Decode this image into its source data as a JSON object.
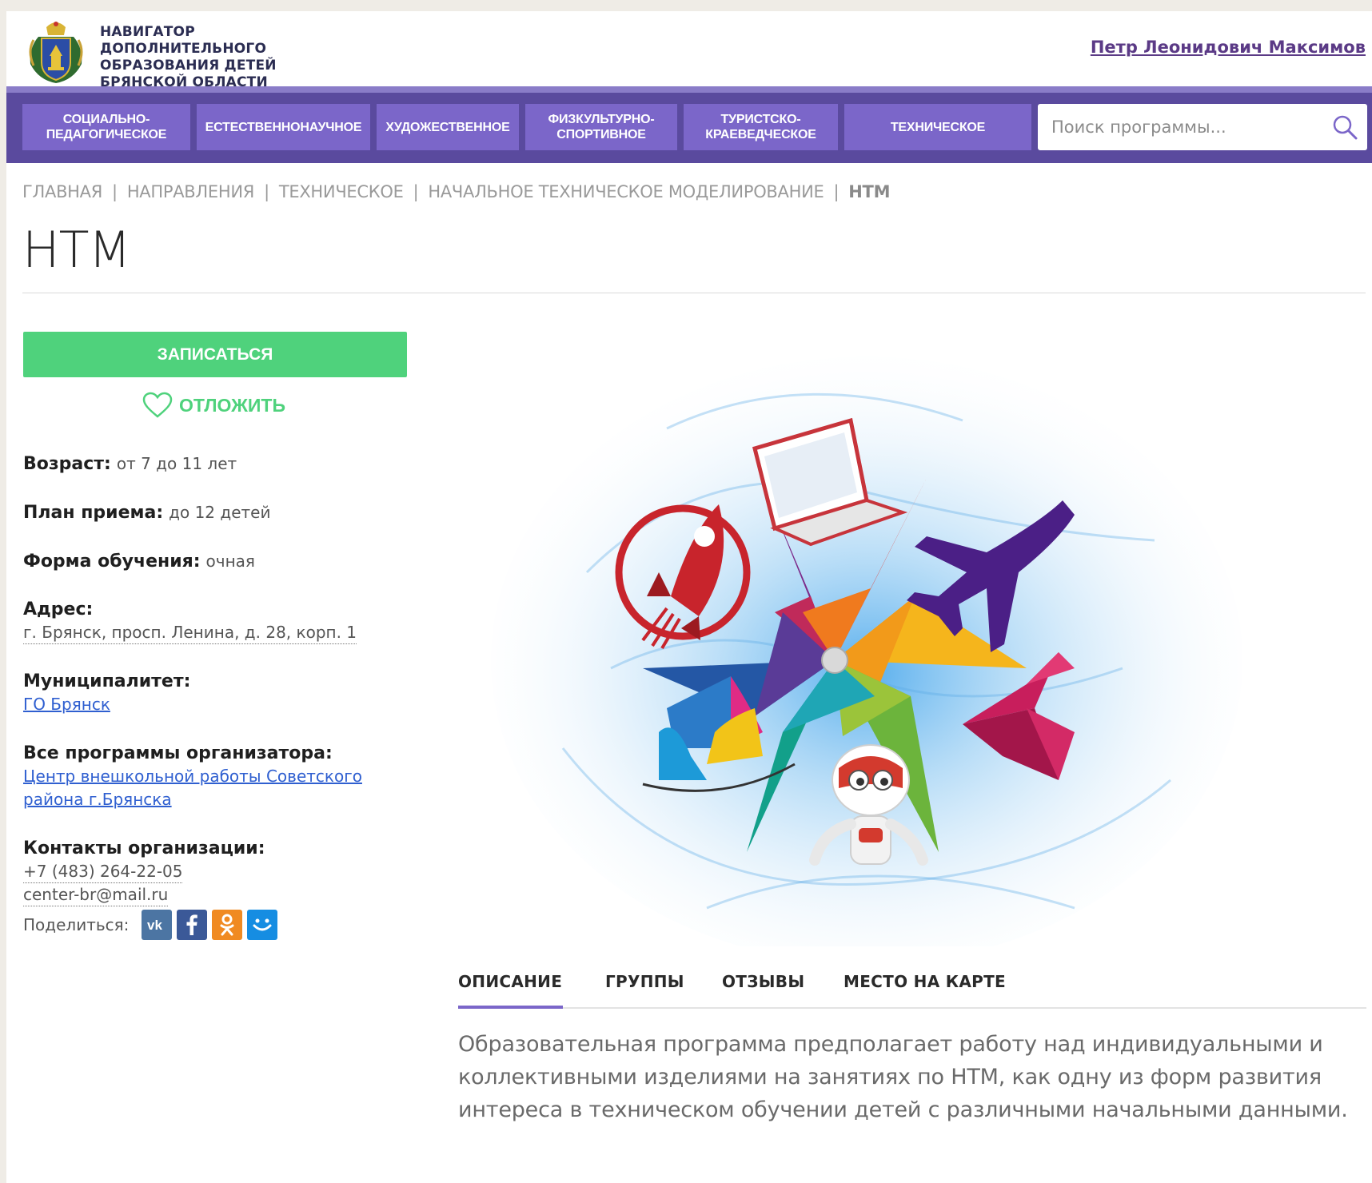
{
  "header": {
    "site_title": "НАВИГАТОР ДОПОЛНИТЕЛЬНОГО ОБРАЗОВАНИЯ ДЕТЕЙ БРЯНСКОЙ ОБЛАСТИ",
    "user_name": "Петр Леонидович Максимов"
  },
  "nav": {
    "items": [
      {
        "label_1": "СОЦИАЛЬНО-",
        "label_2": "ПЕДАГОГИЧЕСКОЕ"
      },
      {
        "label_1": "ЕСТЕСТВЕННОНАУЧНОЕ",
        "label_2": ""
      },
      {
        "label_1": "ХУДОЖЕСТВЕННОЕ",
        "label_2": ""
      },
      {
        "label_1": "ФИЗКУЛЬТУРНО-",
        "label_2": "СПОРТИВНОЕ"
      },
      {
        "label_1": "ТУРИСТСКО-",
        "label_2": "КРАЕВЕДЧЕСКОЕ"
      },
      {
        "label_1": "ТЕХНИЧЕСКОЕ",
        "label_2": ""
      }
    ],
    "search_placeholder": "Поиск программы..."
  },
  "breadcrumb": {
    "items": [
      "ГЛАВНАЯ",
      "НАПРАВЛЕНИЯ",
      "ТЕХНИЧЕСКОЕ",
      "НАЧАЛЬНОЕ ТЕХНИЧЕСКОЕ МОДЕЛИРОВАНИЕ"
    ],
    "separator": "|",
    "current": "НТМ"
  },
  "page": {
    "title": "НТМ"
  },
  "actions": {
    "enroll_label": "ЗАПИСАТЬСЯ",
    "postpone_label": "ОТЛОЖИТЬ"
  },
  "info": {
    "age_label": "Возраст:",
    "age_value": "от 7 до 11 лет",
    "plan_label": "План приема:",
    "plan_value": "до 12 детей",
    "form_label": "Форма обучения:",
    "form_value": "очная",
    "address_label": "Адрес:",
    "address_value": "г. Брянск, просп. Ленина, д. 28, корп. 1",
    "municipality_label": "Муниципалитет:",
    "municipality_value": "ГО Брянск",
    "organizer_label": "Все программы организатора:",
    "organizer_line_1": "Центр внешкольной работы Советского",
    "organizer_line_2": "района г.Брянска",
    "contacts_label": "Контакты организации:",
    "phone": "+7 (483) 264-22-05",
    "email": "center-br@mail.ru",
    "share_label": "Поделиться:"
  },
  "share_icons": [
    "vk-icon",
    "facebook-icon",
    "odnoklassniki-icon",
    "moi-mir-icon"
  ],
  "tabs": {
    "items": [
      "ОПИСАНИЕ",
      "ГРУППЫ",
      "ОТЗЫВЫ",
      "МЕСТО НА КАРТЕ"
    ],
    "active": "ОПИСАНИЕ"
  },
  "description": {
    "text": "Образовательная программа предполагает работу над индивидуальными и коллективными изделиями на занятиях по НТМ, как одну из форм развития интереса в техническом обучении детей с различными начальными данными."
  },
  "colors": {
    "nav_bg": "#5a4a9e",
    "nav_tab": "#7b66c9",
    "accent_green": "#4fd27c",
    "link_blue": "#2f5fd0",
    "user_link": "#5b3a86"
  }
}
